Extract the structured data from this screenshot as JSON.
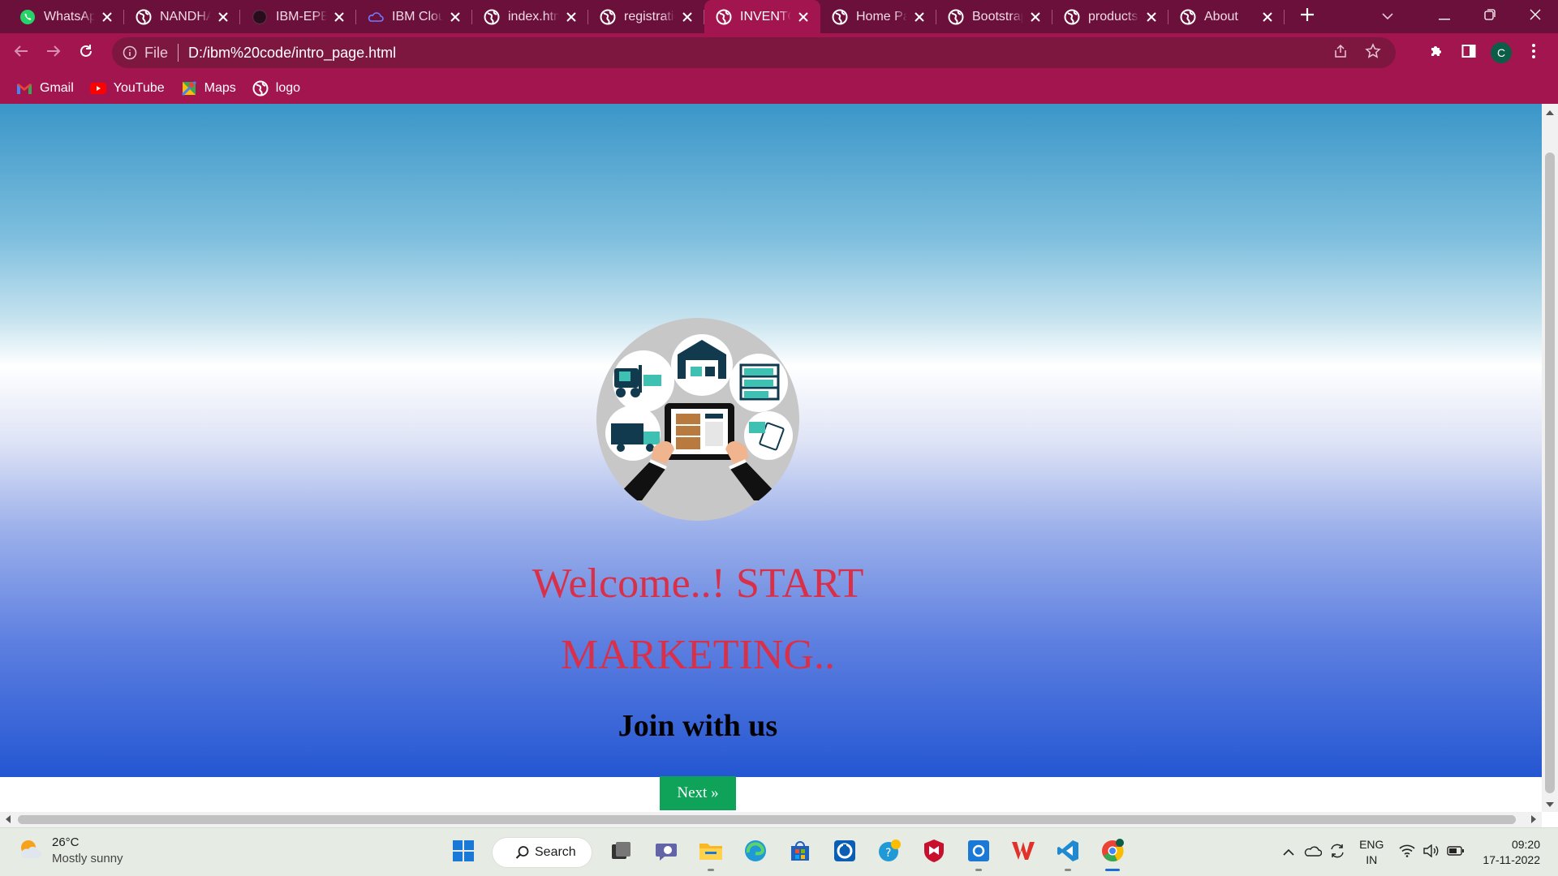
{
  "browser": {
    "tabs": [
      {
        "label": "WhatsApp",
        "icon": "whatsapp-icon"
      },
      {
        "label": "NANDHA",
        "icon": "globe-icon"
      },
      {
        "label": "IBM-EPBL",
        "icon": "github-icon"
      },
      {
        "label": "IBM Cloud",
        "icon": "ibm-cloud-icon"
      },
      {
        "label": "index.html",
        "icon": "globe-icon"
      },
      {
        "label": "registration",
        "icon": "globe-icon"
      },
      {
        "label": "INVENTORY",
        "icon": "globe-icon",
        "active": true
      },
      {
        "label": "Home Page",
        "icon": "globe-icon"
      },
      {
        "label": "Bootstrap",
        "icon": "globe-icon"
      },
      {
        "label": "products",
        "icon": "globe-icon"
      },
      {
        "label": "About",
        "icon": "globe-icon"
      }
    ],
    "address": {
      "scheme": "File",
      "url": "D:/ibm%20code/intro_page.html"
    },
    "profile_initial": "C",
    "bookmarks": [
      {
        "label": "Gmail",
        "icon": "gmail-icon"
      },
      {
        "label": "YouTube",
        "icon": "youtube-icon"
      },
      {
        "label": "Maps",
        "icon": "maps-icon"
      },
      {
        "label": "logo",
        "icon": "globe-icon"
      }
    ]
  },
  "page": {
    "welcome_line1": "Welcome..! START",
    "welcome_line2": "MARKETING..",
    "join": "Join with us",
    "next_button": "Next »"
  },
  "taskbar": {
    "weather_temp": "26°C",
    "weather_desc": "Mostly sunny",
    "search_label": "Search",
    "lang_line1": "ENG",
    "lang_line2": "IN",
    "time": "09:20",
    "date": "17-11-2022"
  },
  "colors": {
    "tabbar": "#6b0f3b",
    "toolbar": "#a3154f",
    "welcome_text": "#d9304a",
    "next_button": "#0fa35a"
  }
}
